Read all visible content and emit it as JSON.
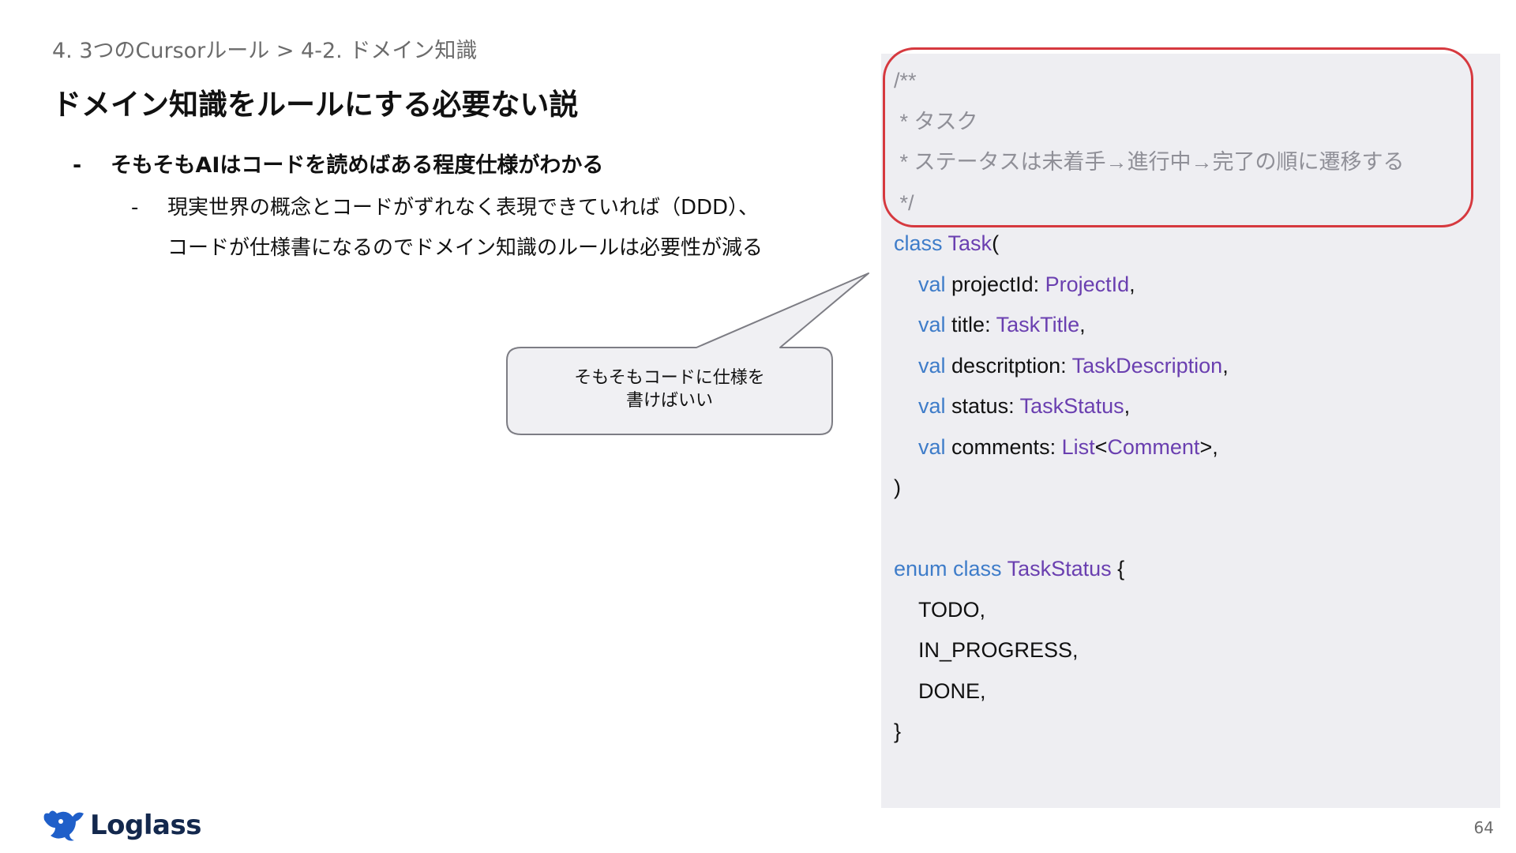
{
  "slide": {
    "breadcrumb": "4. 3つのCursorルール > 4-2. ドメイン知識",
    "title": "ドメイン知識をルールにする必要ない説",
    "bullet1": {
      "dash": "-",
      "text": "そもそもAIはコードを読めばある程度仕様がわかる"
    },
    "bullet2": {
      "dash": "-",
      "line1": "現実世界の概念とコードがずれなく表現できていれば（DDD）、",
      "line2": "コードが仕様書になるのでドメイン知識のルールは必要性が減る"
    },
    "callout": {
      "line1": "そもそもコードに仕様を",
      "line2": "書けばいい"
    },
    "page_number": "64"
  },
  "code": {
    "comment": [
      "/**",
      " * タスク",
      " * ステータスは未着手→進行中→完了の順に遷移する",
      " */"
    ],
    "class_kw": "class",
    "class_name": "Task",
    "open_paren": "(",
    "val_kw": "val",
    "fields": [
      {
        "name": "projectId",
        "type": "ProjectId",
        "suffix": ","
      },
      {
        "name": "title",
        "type": "TaskTitle",
        "suffix": ","
      },
      {
        "name": "descritption",
        "type": "TaskDescription",
        "suffix": ","
      },
      {
        "name": "status",
        "type": "TaskStatus",
        "suffix": ","
      }
    ],
    "comments_field": {
      "name": "comments",
      "list_type": "List",
      "lt": "<",
      "item_type": "Comment",
      "gt": ">",
      "suffix": ","
    },
    "close_paren": ")",
    "enum_kw": "enum class",
    "enum_name": "TaskStatus",
    "open_brace": "{",
    "enum_values": [
      "TODO,",
      "IN_PROGRESS,",
      "DONE,"
    ],
    "close_brace": "}"
  },
  "brand": {
    "logo_text": "Loglass",
    "logo_icon": "whale-icon"
  },
  "colors": {
    "keyword": "#3e7cc9",
    "type": "#6a3fb0",
    "comment": "#8f8f97",
    "highlight_border": "#d6393f",
    "code_background": "#eeeef2"
  }
}
